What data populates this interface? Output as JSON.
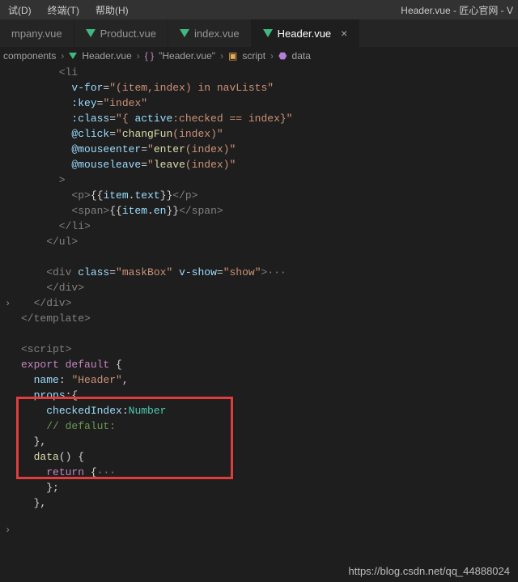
{
  "menu": {
    "debug": "试(D)",
    "terminal": "终端(T)",
    "help": "帮助(H)"
  },
  "title": "Header.vue - 匠心官网 - V",
  "tabs": [
    {
      "label": "mpany.vue",
      "active": false
    },
    {
      "label": "Product.vue",
      "active": false
    },
    {
      "label": "index.vue",
      "active": false
    },
    {
      "label": "Header.vue",
      "active": true
    }
  ],
  "breadcrumb": {
    "p1": "components",
    "p2": "Header.vue",
    "p3": "\"Header.vue\"",
    "p4": "script",
    "p5": "data"
  },
  "code": {
    "l1": "      <li",
    "l2a": "        v-for",
    "l2b": "=",
    "l2c": "\"(item,index) in navLists\"",
    "l3a": "        :key",
    "l3b": "=",
    "l3c": "\"index\"",
    "l4a": "        :class",
    "l4b": "=",
    "l4c": "\"{ ",
    "l4d": "active",
    "l4e": ":checked == index}\"",
    "l5a": "        @click",
    "l5b": "=",
    "l5c": "\"",
    "l5d": "changFun",
    "l5e": "(index)\"",
    "l6a": "        @mouseenter",
    "l6b": "=",
    "l6c": "\"",
    "l6d": "enter",
    "l6e": "(index)\"",
    "l7a": "        @mouseleave",
    "l7b": "=",
    "l7c": "\"",
    "l7d": "leave",
    "l7e": "(index)\"",
    "l8": "      >",
    "l9a": "        <p>",
    "l9b": "{{",
    "l9c": "item",
    "l9d": ".",
    "l9e": "text",
    "l9f": "}}",
    "l9g": "</p>",
    "l10a": "        <span>",
    "l10b": "{{",
    "l10c": "item",
    "l10d": ".",
    "l10e": "en",
    "l10f": "}}",
    "l10g": "</span>",
    "l11": "      </li>",
    "l12": "    </ul>",
    "l13": "",
    "l14a": "    <div ",
    "l14b": "class",
    "l14c": "=",
    "l14d": "\"maskBox\"",
    "l14e": " ",
    "l14f": "v-show",
    "l14g": "=",
    "l14h": "\"show\"",
    "l14i": ">",
    "l14j": "···",
    "l15": "    </div>",
    "l16": "  </div>",
    "l17": "</template>",
    "l18": "",
    "l19": "<script>",
    "l20a": "export",
    "l20b": " ",
    "l20c": "default",
    "l20d": " {",
    "l21a": "  ",
    "l21b": "name",
    "l21c": ": ",
    "l21d": "\"Header\"",
    "l21e": ",",
    "l22a": "  ",
    "l22b": "props",
    "l22c": ":{",
    "l23a": "    ",
    "l23b": "checkedIndex",
    "l23c": ":",
    "l23d": "Number",
    "l24": "    // defalut:",
    "l25": "  },",
    "l26a": "  ",
    "l26b": "data",
    "l26c": "() {",
    "l27a": "    ",
    "l27b": "return",
    "l27c": " {",
    "l27d": "···",
    "l28": "    };",
    "l29": "  },"
  },
  "watermark": "https://blog.csdn.net/qq_44888024"
}
